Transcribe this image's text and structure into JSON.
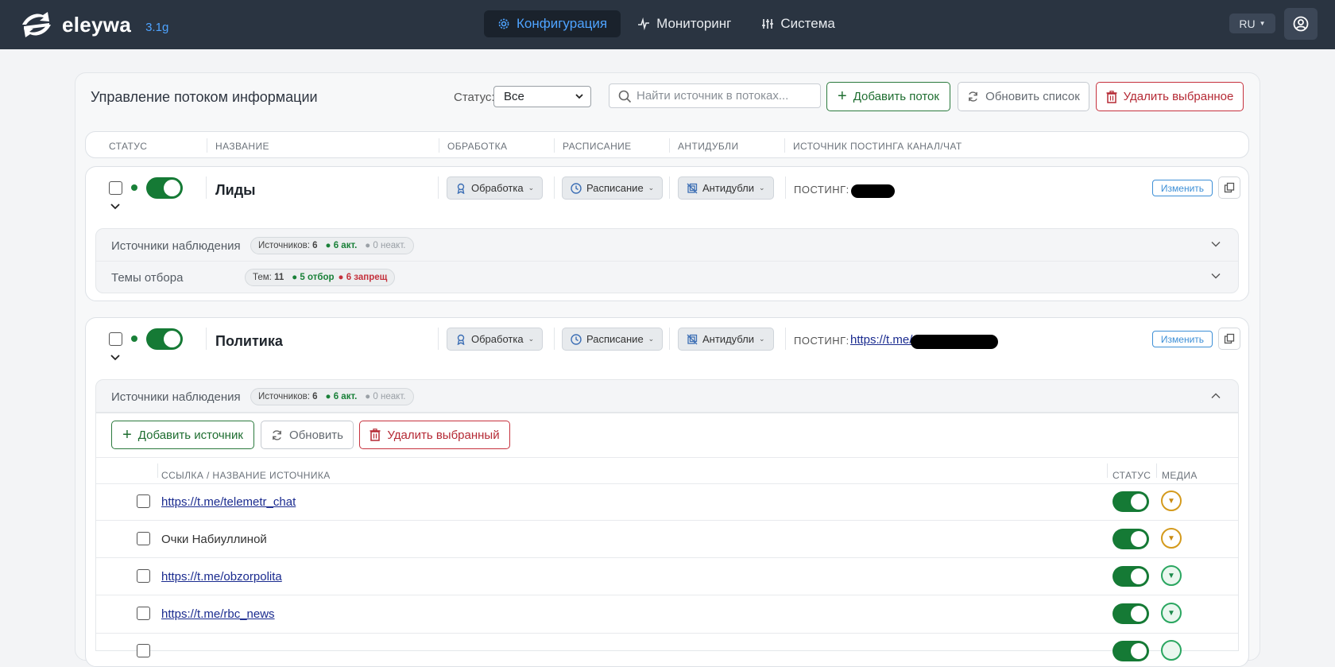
{
  "app": {
    "name": "eleywa",
    "version": "3.1g"
  },
  "nav": {
    "tabs": [
      {
        "label": "Конфигурация",
        "icon": "gear-icon",
        "active": true
      },
      {
        "label": "Мониторинг",
        "icon": "pulse-icon",
        "active": false
      },
      {
        "label": "Система",
        "icon": "sliders-icon",
        "active": false
      }
    ],
    "lang": "RU",
    "user_icon": "user-circle-icon"
  },
  "toolbar": {
    "title": "Управление потоком информации",
    "status_label": "Статус:",
    "status_value": "Все",
    "search_placeholder": "Найти источник в потоках...",
    "add_flow": "Добавить поток",
    "refresh_list": "Обновить список",
    "delete_selected": "Удалить выбранное"
  },
  "columns": [
    "СТАТУС",
    "НАЗВАНИЕ",
    "ОБРАБОТКА",
    "РАСПИСАНИЕ",
    "АНТИДУБЛИ",
    "ИСТОЧНИК ПОСТИНГА КАНАЛ/ЧАТ"
  ],
  "flows": [
    {
      "name": "Лиды",
      "processing": "Обработка",
      "schedule": "Расписание",
      "antidup": "Антидубли",
      "posting_label": "ПОСТИНГ:",
      "posting_link": "",
      "edit": "Изменить",
      "sources_title": "Источники наблюдения",
      "sources_count_label": "Источников:",
      "sources_count": "6",
      "sources_active": "6 акт.",
      "sources_inactive": "0 неакт.",
      "topics_title": "Темы отбора",
      "topics_label": "Тем:",
      "topics_count": "11",
      "topics_select": "5 отбор",
      "topics_forbid": "6 запрещ"
    },
    {
      "name": "Политика",
      "processing": "Обработка",
      "schedule": "Расписание",
      "antidup": "Антидубли",
      "posting_label": "ПОСТИНГ:",
      "posting_link": "https://t.me/",
      "edit": "Изменить",
      "sources_title": "Источники наблюдения",
      "sources_count_label": "Источников:",
      "sources_count": "6",
      "sources_active": "6 акт.",
      "sources_inactive": "0 неакт.",
      "add_source": "Добавить источник",
      "refresh": "Обновить",
      "delete_selected": "Удалить выбранный",
      "src_columns": [
        "ССЫЛКА / НАЗВАНИЕ ИСТОЧНИКА",
        "СТАТУС",
        "МЕДИА"
      ],
      "sources": [
        {
          "label": "https://t.me/telemetr_chat",
          "is_link": true,
          "media": "yellow"
        },
        {
          "label": "Очки Набиуллиной",
          "is_link": false,
          "media": "yellow"
        },
        {
          "label": "https://t.me/obzorpolita",
          "is_link": true,
          "media": "green"
        },
        {
          "label": "https://t.me/rbc_news",
          "is_link": true,
          "media": "green"
        }
      ]
    }
  ]
}
